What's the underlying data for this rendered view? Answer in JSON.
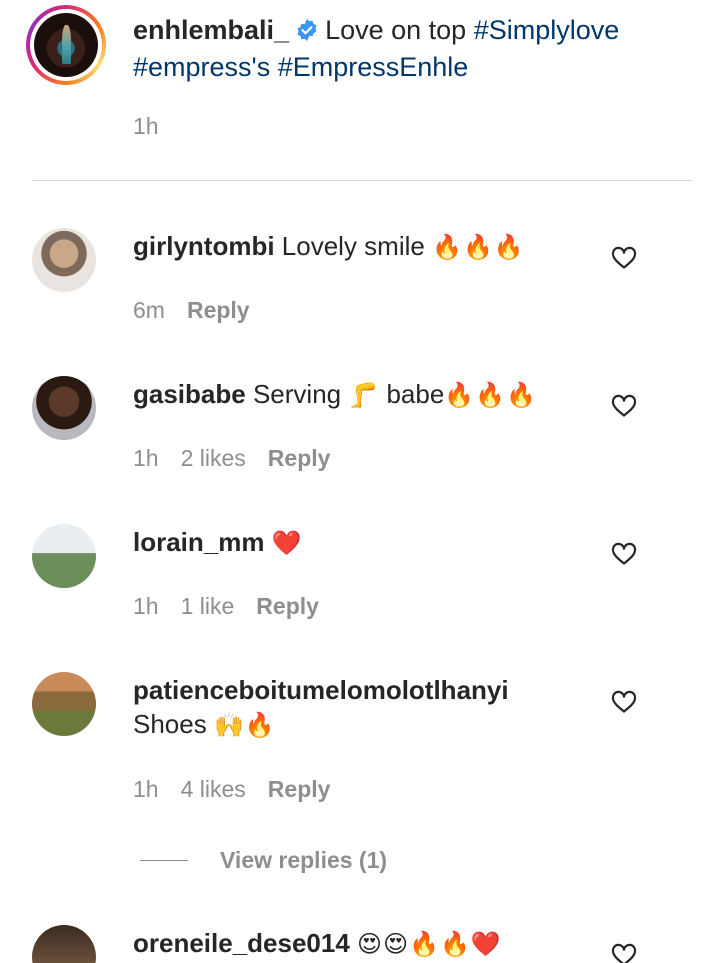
{
  "caption": {
    "username": "enhlembali_",
    "text": "Love on top",
    "hashtag1": "#Simplylove",
    "hashtag2": "#empress's",
    "hashtag3": "#EmpressEnhle",
    "time": "1h"
  },
  "comments": [
    {
      "username": "girlyntombi",
      "text": "Lovely smile",
      "emoji": "🔥🔥🔥",
      "time": "6m",
      "likes": "",
      "reply_label": "Reply"
    },
    {
      "username": "gasibabe",
      "text": "Serving",
      "emoji_mid": "🦵",
      "text2": "babe",
      "emoji": "🔥🔥🔥",
      "time": "1h",
      "likes": "2 likes",
      "reply_label": "Reply"
    },
    {
      "username": "lorain_mm",
      "text": "",
      "emoji": "❤️",
      "time": "1h",
      "likes": "1 like",
      "reply_label": "Reply"
    },
    {
      "username": "patienceboitumelomolotlhanyi",
      "text": "Shoes",
      "emoji": "🙌🔥",
      "time": "1h",
      "likes": "4 likes",
      "reply_label": "Reply"
    },
    {
      "username": "oreneile_dese014",
      "text": "",
      "emoji": "😍😍🔥🔥❤️"
    }
  ],
  "view_replies": "View replies (1)",
  "colors": {
    "text": "#262626",
    "secondary": "#8e8e8e",
    "hashtag": "#00376b",
    "verified": "#3897f0",
    "divider": "#dbdbdb"
  }
}
